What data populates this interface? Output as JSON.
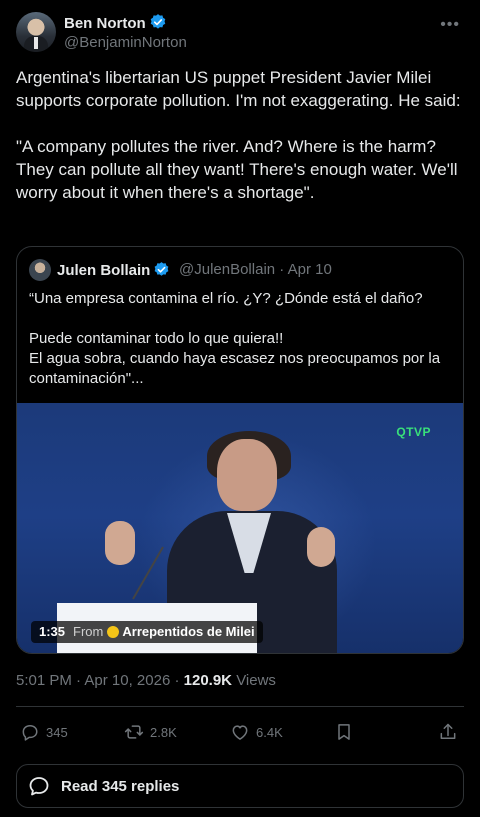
{
  "author": {
    "name": "Ben Norton",
    "handle": "@BenjaminNorton",
    "verified": true
  },
  "tweet": {
    "paragraphs": [
      "Argentina's libertarian US puppet President Javier Milei supports corporate pollution. I'm not exaggerating. He said:",
      "\"A company pollutes the river. And? Where is the harm? They can pollute all they want! There's enough water. We'll worry about it when there's a shortage\"."
    ]
  },
  "quote": {
    "name": "Julen Bollain",
    "handle": "@JulenBollain",
    "date": "Apr 10",
    "verified": true,
    "lines": [
      "“Una empresa contamina el río. ¿Y? ¿Dónde está el daño?",
      "Puede contaminar todo lo que quiera!!",
      "El agua sobra, cuando haya escasez nos preocupamos por la contaminación\"..."
    ],
    "video": {
      "duration": "1:35",
      "from_label": "From",
      "source": "Arrepentidos de Milei",
      "channel_logo": "QTVP"
    }
  },
  "meta": {
    "time": "5:01 PM",
    "date": "Apr 10, 2026",
    "views_count": "120.9K",
    "views_label": "Views"
  },
  "actions": {
    "reply_count": "345",
    "repost_count": "2.8K",
    "like_count": "6.4K"
  },
  "read_replies_label": "Read 345 replies",
  "colors": {
    "background": "#000000",
    "text": "#e7e9ea",
    "muted": "#71767b",
    "verified": "#1d9bf0",
    "border": "#2f3336"
  },
  "icons": [
    "verified-badge-icon",
    "more-icon",
    "reply-icon",
    "repost-icon",
    "like-icon",
    "bookmark-icon",
    "share-icon",
    "speech-bubble-icon"
  ]
}
